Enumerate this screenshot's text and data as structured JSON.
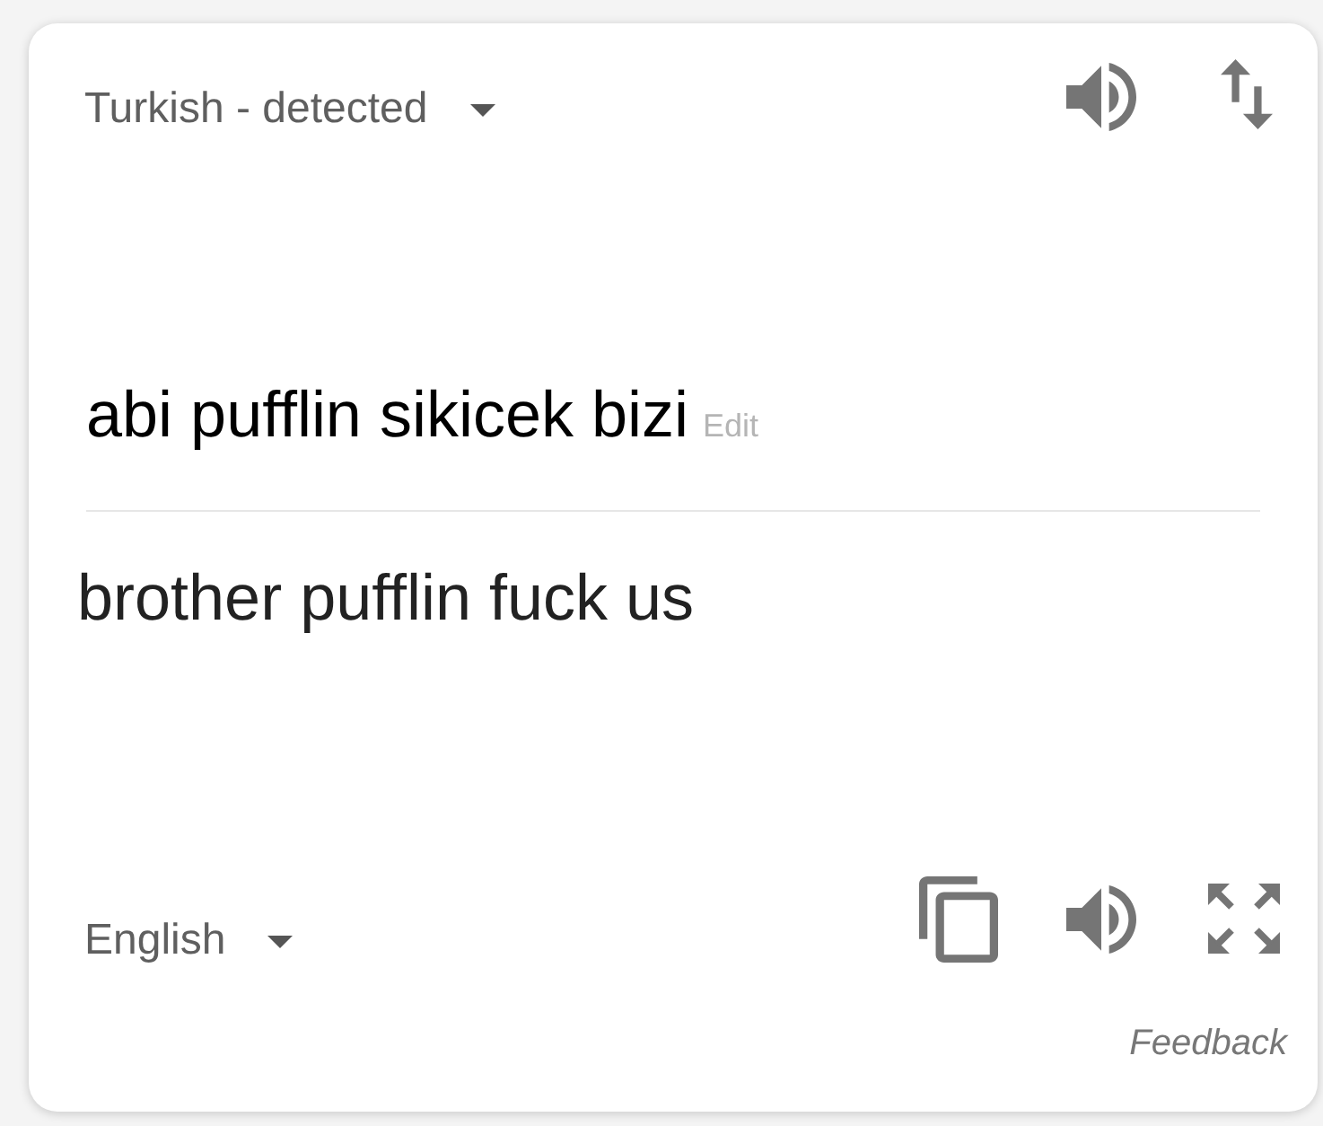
{
  "source": {
    "language": {
      "label": "Turkish - detected"
    },
    "text": "abi pufflin sikicek bizi",
    "edit_link": "Edit"
  },
  "target": {
    "language": {
      "label": "English"
    },
    "text": "brother pufflin fuck us"
  },
  "feedback_link": "Feedback"
}
